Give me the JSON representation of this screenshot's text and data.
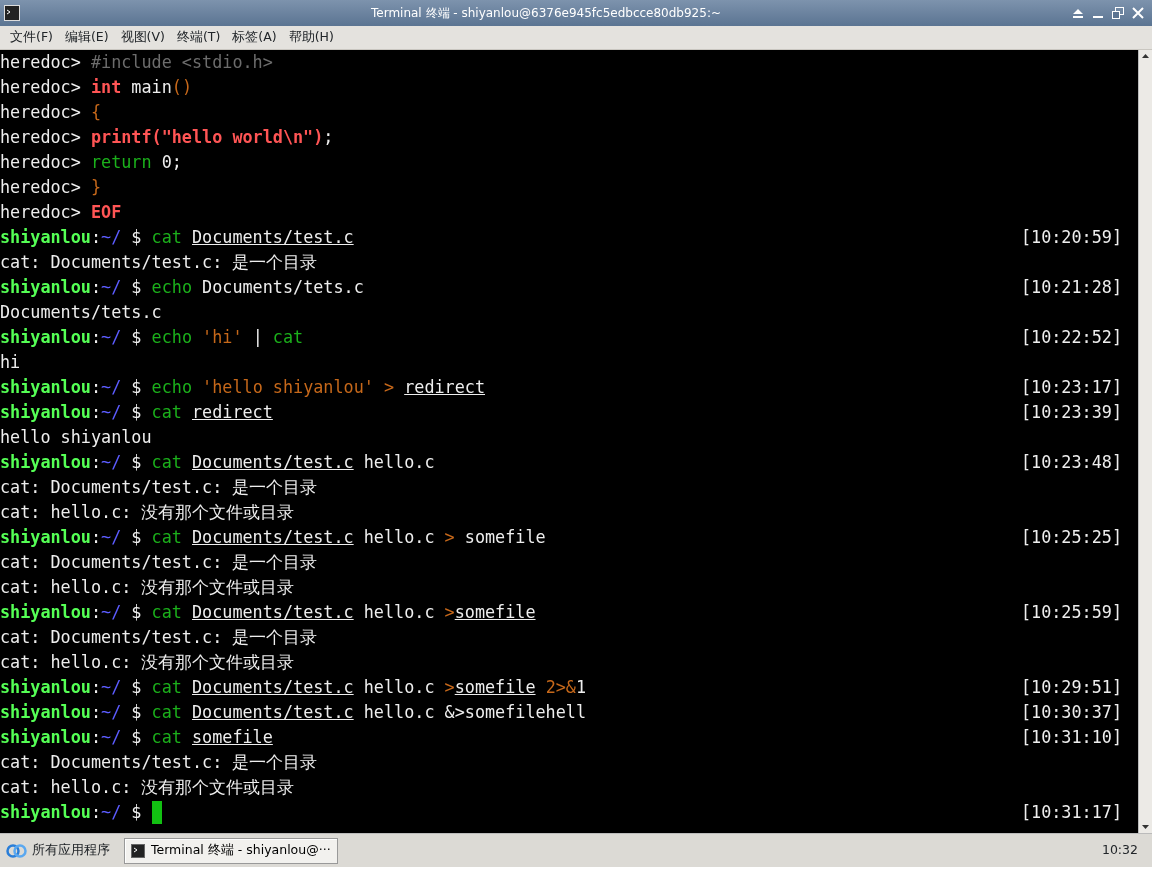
{
  "window": {
    "title": "Terminal 终端 - shiyanlou@6376e945fc5edbcce80db925:~"
  },
  "menu": [
    "文件(F)",
    "编辑(E)",
    "视图(V)",
    "终端(T)",
    "标签(A)",
    "帮助(H)"
  ],
  "terminal": {
    "lines": [
      {
        "kind": "output",
        "segs": [
          {
            "t": "heredoc> ",
            "kind": "plain"
          },
          {
            "t": "#include <stdio.h>",
            "kind": "comment"
          }
        ]
      },
      {
        "kind": "output",
        "segs": [
          {
            "t": "heredoc> ",
            "kind": "plain"
          },
          {
            "t": "int",
            "kind": "keyword"
          },
          {
            "t": " main",
            "kind": "plain"
          },
          {
            "t": "()",
            "kind": "operator"
          }
        ]
      },
      {
        "kind": "output",
        "segs": [
          {
            "t": "heredoc> ",
            "kind": "plain"
          },
          {
            "t": "{",
            "kind": "operator"
          }
        ]
      },
      {
        "kind": "output",
        "segs": [
          {
            "t": "heredoc> ",
            "kind": "plain"
          },
          {
            "t": "printf(\"hello world\\n\")",
            "kind": "keyword"
          },
          {
            "t": ";",
            "kind": "plain"
          }
        ]
      },
      {
        "kind": "output",
        "segs": [
          {
            "t": "heredoc> ",
            "kind": "plain"
          },
          {
            "t": "return",
            "kind": "command"
          },
          {
            "t": " 0;",
            "kind": "plain"
          }
        ]
      },
      {
        "kind": "output",
        "segs": [
          {
            "t": "heredoc> ",
            "kind": "plain"
          },
          {
            "t": "}",
            "kind": "operator"
          }
        ]
      },
      {
        "kind": "output",
        "segs": [
          {
            "t": "heredoc> ",
            "kind": "plain"
          },
          {
            "t": "EOF",
            "kind": "keyword"
          }
        ]
      },
      {
        "kind": "prompt",
        "user": "shiyanlou",
        "sep": ":",
        "path": "~/",
        "sym": "$",
        "segs": [
          {
            "t": "cat ",
            "kind": "command"
          },
          {
            "t": "Documents/test.c",
            "kind": "link"
          }
        ],
        "time": "[10:20:59]"
      },
      {
        "kind": "output",
        "segs": [
          {
            "t": "cat: Documents/test.c: 是一个目录",
            "kind": "plain"
          }
        ]
      },
      {
        "kind": "prompt",
        "user": "shiyanlou",
        "sep": ":",
        "path": "~/",
        "sym": "$",
        "segs": [
          {
            "t": "echo",
            "kind": "command"
          },
          {
            "t": " Documents/tets.c",
            "kind": "plain"
          }
        ],
        "time": "[10:21:28]"
      },
      {
        "kind": "output",
        "segs": [
          {
            "t": "Documents/tets.c",
            "kind": "plain"
          }
        ]
      },
      {
        "kind": "prompt",
        "user": "shiyanlou",
        "sep": ":",
        "path": "~/",
        "sym": "$",
        "segs": [
          {
            "t": "echo ",
            "kind": "command"
          },
          {
            "t": "'hi'",
            "kind": "operator"
          },
          {
            "t": " | ",
            "kind": "plain"
          },
          {
            "t": "cat",
            "kind": "command"
          }
        ],
        "time": "[10:22:52]"
      },
      {
        "kind": "output",
        "segs": [
          {
            "t": "hi",
            "kind": "plain"
          }
        ]
      },
      {
        "kind": "prompt",
        "user": "shiyanlou",
        "sep": ":",
        "path": "~/",
        "sym": "$",
        "segs": [
          {
            "t": "echo ",
            "kind": "command"
          },
          {
            "t": "'hello shiyanlou' > ",
            "kind": "operator"
          },
          {
            "t": "redirect",
            "kind": "link"
          }
        ],
        "time": "[10:23:17]"
      },
      {
        "kind": "prompt",
        "user": "shiyanlou",
        "sep": ":",
        "path": "~/",
        "sym": "$",
        "segs": [
          {
            "t": "cat ",
            "kind": "command"
          },
          {
            "t": "redirect",
            "kind": "link"
          }
        ],
        "time": "[10:23:39]"
      },
      {
        "kind": "output",
        "segs": [
          {
            "t": "hello shiyanlou",
            "kind": "plain"
          }
        ]
      },
      {
        "kind": "prompt",
        "user": "shiyanlou",
        "sep": ":",
        "path": "~/",
        "sym": "$",
        "segs": [
          {
            "t": "cat ",
            "kind": "command"
          },
          {
            "t": "Documents/test.c",
            "kind": "link"
          },
          {
            "t": " hello.c",
            "kind": "plain"
          }
        ],
        "time": "[10:23:48]"
      },
      {
        "kind": "output",
        "segs": [
          {
            "t": "cat: Documents/test.c: 是一个目录",
            "kind": "plain"
          }
        ]
      },
      {
        "kind": "output",
        "segs": [
          {
            "t": "cat: hello.c: 没有那个文件或目录",
            "kind": "plain"
          }
        ]
      },
      {
        "kind": "prompt",
        "user": "shiyanlou",
        "sep": ":",
        "path": "~/",
        "sym": "$",
        "segs": [
          {
            "t": "cat ",
            "kind": "command"
          },
          {
            "t": "Documents/test.c",
            "kind": "link"
          },
          {
            "t": " hello.c ",
            "kind": "plain"
          },
          {
            "t": ">",
            "kind": "operator"
          },
          {
            "t": " somefile",
            "kind": "plain"
          }
        ],
        "time": "[10:25:25]"
      },
      {
        "kind": "output",
        "segs": [
          {
            "t": "cat: Documents/test.c: 是一个目录",
            "kind": "plain"
          }
        ]
      },
      {
        "kind": "output",
        "segs": [
          {
            "t": "cat: hello.c: 没有那个文件或目录",
            "kind": "plain"
          }
        ]
      },
      {
        "kind": "prompt",
        "user": "shiyanlou",
        "sep": ":",
        "path": "~/",
        "sym": "$",
        "segs": [
          {
            "t": "cat ",
            "kind": "command"
          },
          {
            "t": "Documents/test.c",
            "kind": "link"
          },
          {
            "t": " hello.c ",
            "kind": "plain"
          },
          {
            "t": ">",
            "kind": "operator"
          },
          {
            "t": "somefile",
            "kind": "link"
          }
        ],
        "time": "[10:25:59]"
      },
      {
        "kind": "output",
        "segs": [
          {
            "t": "cat: Documents/test.c: 是一个目录",
            "kind": "plain"
          }
        ]
      },
      {
        "kind": "output",
        "segs": [
          {
            "t": "cat: hello.c: 没有那个文件或目录",
            "kind": "plain"
          }
        ]
      },
      {
        "kind": "prompt",
        "user": "shiyanlou",
        "sep": ":",
        "path": "~/",
        "sym": "$",
        "segs": [
          {
            "t": "cat ",
            "kind": "command"
          },
          {
            "t": "Documents/test.c",
            "kind": "link"
          },
          {
            "t": " hello.c ",
            "kind": "plain"
          },
          {
            "t": ">",
            "kind": "operator"
          },
          {
            "t": "somefile",
            "kind": "link"
          },
          {
            "t": " 2>&",
            "kind": "operator"
          },
          {
            "t": "1",
            "kind": "plain"
          }
        ],
        "time": "[10:29:51]"
      },
      {
        "kind": "prompt",
        "user": "shiyanlou",
        "sep": ":",
        "path": "~/",
        "sym": "$",
        "segs": [
          {
            "t": "cat ",
            "kind": "command"
          },
          {
            "t": "Documents/test.c",
            "kind": "link"
          },
          {
            "t": " hello.c &>somefilehell",
            "kind": "plain"
          }
        ],
        "time": "[10:30:37]"
      },
      {
        "kind": "prompt",
        "user": "shiyanlou",
        "sep": ":",
        "path": "~/",
        "sym": "$",
        "segs": [
          {
            "t": "cat ",
            "kind": "command"
          },
          {
            "t": "somefile",
            "kind": "link"
          }
        ],
        "time": "[10:31:10]"
      },
      {
        "kind": "output",
        "segs": [
          {
            "t": "cat: Documents/test.c: 是一个目录",
            "kind": "plain"
          }
        ]
      },
      {
        "kind": "output",
        "segs": [
          {
            "t": "cat: hello.c: 没有那个文件或目录",
            "kind": "plain"
          }
        ]
      },
      {
        "kind": "prompt",
        "user": "shiyanlou",
        "sep": ":",
        "path": "~/",
        "sym": "$",
        "cursor": true,
        "time": "[10:31:17]"
      }
    ]
  },
  "taskbar": {
    "start_label": "所有应用程序",
    "tasks": [
      {
        "label": "Terminal 终端 - shiyanlou@···",
        "selected": true
      }
    ],
    "clock": "10:32"
  }
}
